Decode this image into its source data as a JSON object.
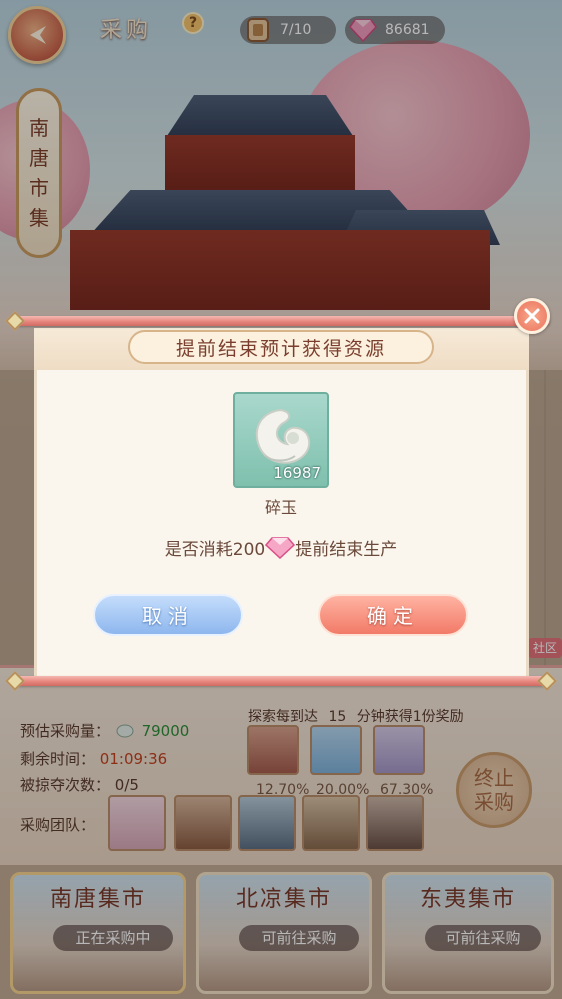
{
  "header": {
    "title": "采购",
    "help_label": "?",
    "stamina": "7/10",
    "gems": "86681"
  },
  "market_banner": [
    "南",
    "唐",
    "市",
    "集"
  ],
  "dialog": {
    "title": "提前结束预计获得资源",
    "item": {
      "count": "16987",
      "name": "碎玉",
      "icon": "jade-pendant-icon"
    },
    "confirm_prefix": "是否消耗200",
    "confirm_suffix": "提前结束生产",
    "cancel_label": "取消",
    "confirm_label": "确定"
  },
  "panel": {
    "est_label": "预估采购量：",
    "est_value": "79000",
    "remain_label": "剩余时间：",
    "remain_value": "01:09:36",
    "raid_label": "被掠夺次数：",
    "raid_value": "0/5",
    "explore_prefix": "探索每到达",
    "explore_num": "15",
    "explore_suffix": "分钟获得1份奖励",
    "percents": [
      "12.70%",
      "20.00%",
      "67.30%"
    ],
    "team_label": "采购团队：",
    "end_label": [
      "终止",
      "采购"
    ]
  },
  "markets": [
    {
      "name": "南唐集市",
      "status": "正在采购中"
    },
    {
      "name": "北凉集市",
      "status": "可前往采购"
    },
    {
      "name": "东夷集市",
      "status": "可前往采购"
    }
  ],
  "community_label": "社区",
  "colors": {
    "accent_red": "#f27a68",
    "accent_blue": "#8eb7ee",
    "gem_pink": "#e9598f"
  }
}
